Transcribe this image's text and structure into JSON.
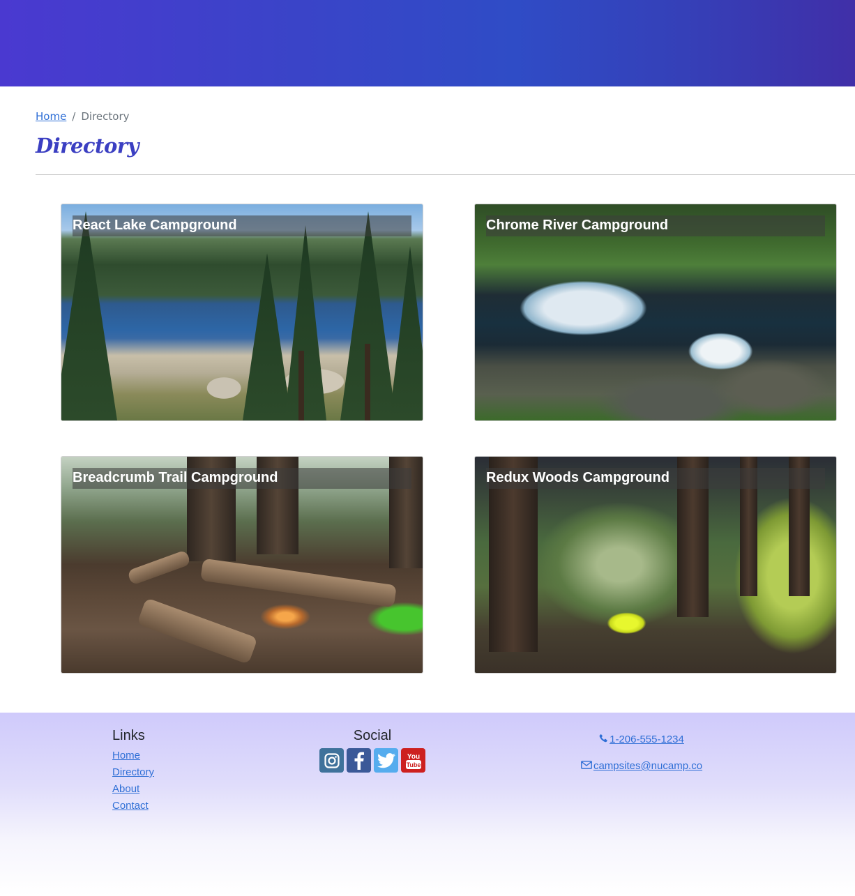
{
  "breadcrumb": {
    "home": "Home",
    "separator": "/",
    "current": "Directory"
  },
  "page": {
    "title": "Directory"
  },
  "campsites": [
    {
      "name": "React Lake Campground",
      "image": "lake"
    },
    {
      "name": "Chrome River Campground",
      "image": "river"
    },
    {
      "name": "Breadcrumb Trail Campground",
      "image": "campfire"
    },
    {
      "name": "Redux Woods Campground",
      "image": "woods"
    }
  ],
  "footer": {
    "links_heading": "Links",
    "links": [
      "Home",
      "Directory",
      "About",
      "Contact"
    ],
    "social_heading": "Social",
    "social": [
      "instagram-icon",
      "facebook-icon",
      "twitter-icon",
      "youtube-icon"
    ],
    "phone": "1-206-555-1234",
    "email": "campsites@nucamp.co"
  },
  "colors": {
    "header_gradient_start": "#4a39d0",
    "header_gradient_end": "#402fa8",
    "title": "#3b3fc2",
    "link": "#2f6fd6",
    "footer_top": "#cfcafb"
  }
}
